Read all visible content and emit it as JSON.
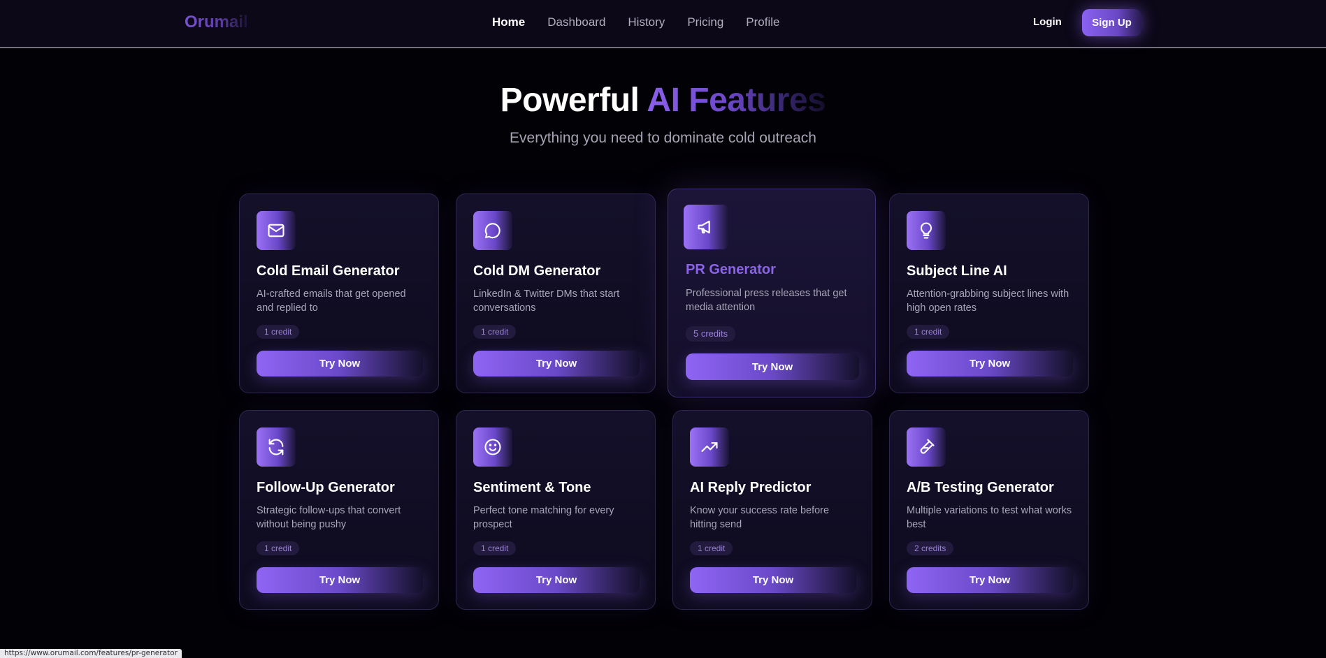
{
  "nav": {
    "logo": "Orumail",
    "links": [
      "Home",
      "Dashboard",
      "History",
      "Pricing",
      "Profile"
    ],
    "active": "Home",
    "login": "Login",
    "signup": "Sign Up"
  },
  "hero": {
    "title_white": "Powerful",
    "title_gradient": "AI Features",
    "subtitle": "Everything you need to dominate cold outreach"
  },
  "features": [
    {
      "title": "Cold Email Generator",
      "description": "AI-crafted emails that get opened and replied to",
      "credit": "1 credit",
      "button": "Try Now",
      "icon": "mail-icon"
    },
    {
      "title": "Cold DM Generator",
      "description": "LinkedIn & Twitter DMs that start conversations",
      "credit": "1 credit",
      "button": "Try Now",
      "icon": "chat-bubble-icon"
    },
    {
      "title": "PR Generator",
      "description": "Professional press releases that get media attention",
      "credit": "5 credits",
      "button": "Try Now",
      "icon": "megaphone-icon"
    },
    {
      "title": "Subject Line AI",
      "description": "Attention-grabbing subject lines with high open rates",
      "credit": "1 credit",
      "button": "Try Now",
      "icon": "lightbulb-icon"
    },
    {
      "title": "Follow-Up Generator",
      "description": "Strategic follow-ups that convert without being pushy",
      "credit": "1 credit",
      "button": "Try Now",
      "icon": "refresh-icon"
    },
    {
      "title": "Sentiment & Tone",
      "description": "Perfect tone matching for every prospect",
      "credit": "1 credit",
      "button": "Try Now",
      "icon": "smiley-icon"
    },
    {
      "title": "AI Reply Predictor",
      "description": "Know your success rate before hitting send",
      "credit": "1 credit",
      "button": "Try Now",
      "icon": "trending-up-icon"
    },
    {
      "title": "A/B Testing Generator",
      "description": "Multiple variations to test what works best",
      "credit": "2 credits",
      "button": "Try Now",
      "icon": "test-tube-icon"
    }
  ],
  "status_bar": {
    "url": "https://www.orumail.com/features/pr-generator"
  },
  "colors": {
    "background": "#020105",
    "accent": "#8b60ec",
    "card": "#14102a"
  }
}
